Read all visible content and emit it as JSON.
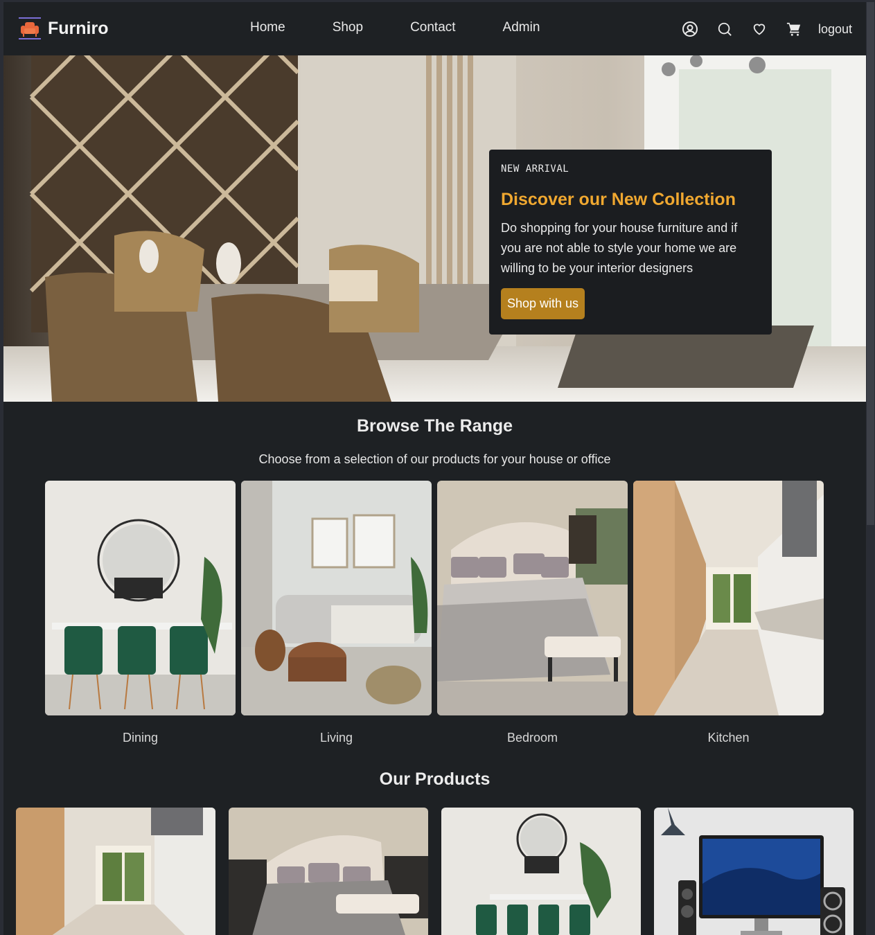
{
  "brand": {
    "name": "Furniro",
    "accent": "#f0a830",
    "button": "#b5801e"
  },
  "nav": {
    "items": [
      "Home",
      "Shop",
      "Contact",
      "Admin"
    ]
  },
  "header_icons": [
    "user-icon",
    "search-icon",
    "heart-icon",
    "cart-icon"
  ],
  "header": {
    "logout_label": "logout"
  },
  "hero": {
    "kicker": "NEW ARRIVAL",
    "title": "Discover our New Collection",
    "description": "Do shopping for your house furniture and if you are not able to style your home we are willing to be your interior designers",
    "cta_label": "Shop with us"
  },
  "browse": {
    "title": "Browse The Range",
    "subtitle": "Choose from a selection of our products for your house or office",
    "categories": [
      "Dining",
      "Living",
      "Bedroom",
      "Kitchen"
    ]
  },
  "products": {
    "title": "Our Products"
  }
}
